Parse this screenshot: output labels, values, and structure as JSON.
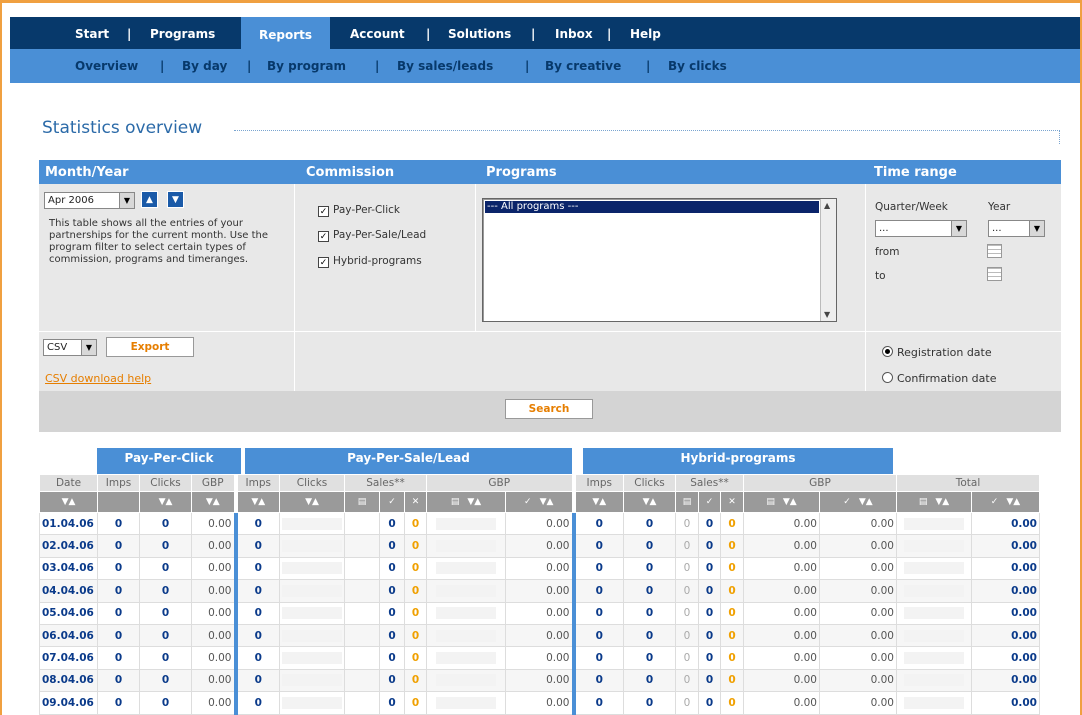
{
  "topnav": {
    "items": [
      "Start",
      "Programs",
      "Reports",
      "Account",
      "Solutions",
      "Inbox",
      "Help"
    ],
    "separator": "|"
  },
  "subnav": {
    "items": [
      "Overview",
      "By day",
      "By program",
      "By sales/leads",
      "By creative",
      "By clicks"
    ],
    "separator": "|"
  },
  "page_title": "Statistics overview",
  "filter": {
    "headers": {
      "month_year": "Month/Year",
      "commission": "Commission",
      "programs": "Programs",
      "time_range": "Time range"
    },
    "month_select": "Apr 2006",
    "description": "This table shows all the entries of your partnerships for the current month. Use the program filter to select certain types of commission, programs and timeranges.",
    "commission_options": [
      {
        "label": "Pay-Per-Click",
        "checked": true
      },
      {
        "label": "Pay-Per-Sale/Lead",
        "checked": true
      },
      {
        "label": "Hybrid-programs",
        "checked": true
      }
    ],
    "programs_list": [
      "--- All programs ---"
    ],
    "quarter_week_label": "Quarter/Week",
    "year_label": "Year",
    "quarter_select": "...",
    "year_select": "...",
    "from_label": "from",
    "to_label": "to",
    "export_format": "CSV",
    "export_button": "Export",
    "csv_help": "CSV download help",
    "date_type": [
      {
        "label": "Registration date",
        "selected": true
      },
      {
        "label": "Confirmation date",
        "selected": false
      }
    ],
    "search_button": "Search"
  },
  "table": {
    "group_headers": [
      "Pay-Per-Click",
      "Pay-Per-Sale/Lead",
      "Hybrid-programs"
    ],
    "sub_headers": {
      "date": "Date",
      "imps": "Imps",
      "clicks": "Clicks",
      "gbp": "GBP",
      "sales": "Sales**",
      "total": "Total"
    },
    "rows": [
      {
        "date": "01.04.06",
        "ppc_imps": "0",
        "ppc_clicks": "0",
        "ppc_gbp": "0.00",
        "psl_imps": "0",
        "psl_s1": "0",
        "psl_s2": "0",
        "psl_gbp": "0.00",
        "hy_imps": "0",
        "hy_clicks": "0",
        "hy_s0": "0",
        "hy_s1": "0",
        "hy_s2": "0",
        "hy_g1": "0.00",
        "hy_g2": "0.00",
        "total": "0.00"
      },
      {
        "date": "02.04.06",
        "ppc_imps": "0",
        "ppc_clicks": "0",
        "ppc_gbp": "0.00",
        "psl_imps": "0",
        "psl_s1": "0",
        "psl_s2": "0",
        "psl_gbp": "0.00",
        "hy_imps": "0",
        "hy_clicks": "0",
        "hy_s0": "0",
        "hy_s1": "0",
        "hy_s2": "0",
        "hy_g1": "0.00",
        "hy_g2": "0.00",
        "total": "0.00"
      },
      {
        "date": "03.04.06",
        "ppc_imps": "0",
        "ppc_clicks": "0",
        "ppc_gbp": "0.00",
        "psl_imps": "0",
        "psl_s1": "0",
        "psl_s2": "0",
        "psl_gbp": "0.00",
        "hy_imps": "0",
        "hy_clicks": "0",
        "hy_s0": "0",
        "hy_s1": "0",
        "hy_s2": "0",
        "hy_g1": "0.00",
        "hy_g2": "0.00",
        "total": "0.00"
      },
      {
        "date": "04.04.06",
        "ppc_imps": "0",
        "ppc_clicks": "0",
        "ppc_gbp": "0.00",
        "psl_imps": "0",
        "psl_s1": "0",
        "psl_s2": "0",
        "psl_gbp": "0.00",
        "hy_imps": "0",
        "hy_clicks": "0",
        "hy_s0": "0",
        "hy_s1": "0",
        "hy_s2": "0",
        "hy_g1": "0.00",
        "hy_g2": "0.00",
        "total": "0.00"
      },
      {
        "date": "05.04.06",
        "ppc_imps": "0",
        "ppc_clicks": "0",
        "ppc_gbp": "0.00",
        "psl_imps": "0",
        "psl_s1": "0",
        "psl_s2": "0",
        "psl_gbp": "0.00",
        "hy_imps": "0",
        "hy_clicks": "0",
        "hy_s0": "0",
        "hy_s1": "0",
        "hy_s2": "0",
        "hy_g1": "0.00",
        "hy_g2": "0.00",
        "total": "0.00"
      },
      {
        "date": "06.04.06",
        "ppc_imps": "0",
        "ppc_clicks": "0",
        "ppc_gbp": "0.00",
        "psl_imps": "0",
        "psl_s1": "0",
        "psl_s2": "0",
        "psl_gbp": "0.00",
        "hy_imps": "0",
        "hy_clicks": "0",
        "hy_s0": "0",
        "hy_s1": "0",
        "hy_s2": "0",
        "hy_g1": "0.00",
        "hy_g2": "0.00",
        "total": "0.00"
      },
      {
        "date": "07.04.06",
        "ppc_imps": "0",
        "ppc_clicks": "0",
        "ppc_gbp": "0.00",
        "psl_imps": "0",
        "psl_s1": "0",
        "psl_s2": "0",
        "psl_gbp": "0.00",
        "hy_imps": "0",
        "hy_clicks": "0",
        "hy_s0": "0",
        "hy_s1": "0",
        "hy_s2": "0",
        "hy_g1": "0.00",
        "hy_g2": "0.00",
        "total": "0.00"
      },
      {
        "date": "08.04.06",
        "ppc_imps": "0",
        "ppc_clicks": "0",
        "ppc_gbp": "0.00",
        "psl_imps": "0",
        "psl_s1": "0",
        "psl_s2": "0",
        "psl_gbp": "0.00",
        "hy_imps": "0",
        "hy_clicks": "0",
        "hy_s0": "0",
        "hy_s1": "0",
        "hy_s2": "0",
        "hy_g1": "0.00",
        "hy_g2": "0.00",
        "total": "0.00"
      },
      {
        "date": "09.04.06",
        "ppc_imps": "0",
        "ppc_clicks": "0",
        "ppc_gbp": "0.00",
        "psl_imps": "0",
        "psl_s1": "0",
        "psl_s2": "0",
        "psl_gbp": "0.00",
        "hy_imps": "0",
        "hy_clicks": "0",
        "hy_s0": "0",
        "hy_s1": "0",
        "hy_s2": "0",
        "hy_g1": "0.00",
        "hy_g2": "0.00",
        "total": "0.00"
      }
    ]
  },
  "colors": {
    "nav_dark": "#07396b",
    "nav_light": "#4a8fd6",
    "accent_orange": "#f0a040"
  },
  "icons": {
    "sort": "sort-arrows-icon",
    "calendar": "calendar-icon",
    "check": "check-icon",
    "cross": "cross-icon",
    "document": "document-icon"
  }
}
